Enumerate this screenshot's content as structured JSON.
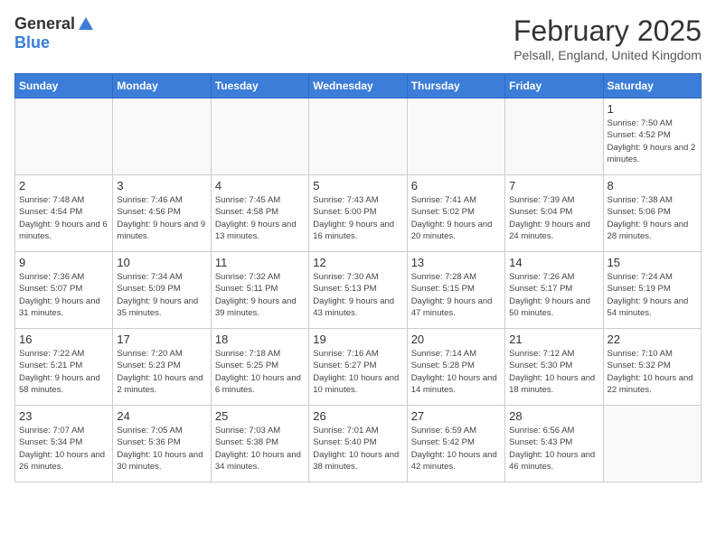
{
  "logo": {
    "general": "General",
    "blue": "Blue"
  },
  "title": "February 2025",
  "location": "Pelsall, England, United Kingdom",
  "weekdays": [
    "Sunday",
    "Monday",
    "Tuesday",
    "Wednesday",
    "Thursday",
    "Friday",
    "Saturday"
  ],
  "days": [
    {
      "num": "",
      "info": ""
    },
    {
      "num": "",
      "info": ""
    },
    {
      "num": "",
      "info": ""
    },
    {
      "num": "",
      "info": ""
    },
    {
      "num": "",
      "info": ""
    },
    {
      "num": "",
      "info": ""
    },
    {
      "num": "1",
      "info": "Sunrise: 7:50 AM\nSunset: 4:52 PM\nDaylight: 9 hours and 2 minutes."
    },
    {
      "num": "2",
      "info": "Sunrise: 7:48 AM\nSunset: 4:54 PM\nDaylight: 9 hours and 6 minutes."
    },
    {
      "num": "3",
      "info": "Sunrise: 7:46 AM\nSunset: 4:56 PM\nDaylight: 9 hours and 9 minutes."
    },
    {
      "num": "4",
      "info": "Sunrise: 7:45 AM\nSunset: 4:58 PM\nDaylight: 9 hours and 13 minutes."
    },
    {
      "num": "5",
      "info": "Sunrise: 7:43 AM\nSunset: 5:00 PM\nDaylight: 9 hours and 16 minutes."
    },
    {
      "num": "6",
      "info": "Sunrise: 7:41 AM\nSunset: 5:02 PM\nDaylight: 9 hours and 20 minutes."
    },
    {
      "num": "7",
      "info": "Sunrise: 7:39 AM\nSunset: 5:04 PM\nDaylight: 9 hours and 24 minutes."
    },
    {
      "num": "8",
      "info": "Sunrise: 7:38 AM\nSunset: 5:06 PM\nDaylight: 9 hours and 28 minutes."
    },
    {
      "num": "9",
      "info": "Sunrise: 7:36 AM\nSunset: 5:07 PM\nDaylight: 9 hours and 31 minutes."
    },
    {
      "num": "10",
      "info": "Sunrise: 7:34 AM\nSunset: 5:09 PM\nDaylight: 9 hours and 35 minutes."
    },
    {
      "num": "11",
      "info": "Sunrise: 7:32 AM\nSunset: 5:11 PM\nDaylight: 9 hours and 39 minutes."
    },
    {
      "num": "12",
      "info": "Sunrise: 7:30 AM\nSunset: 5:13 PM\nDaylight: 9 hours and 43 minutes."
    },
    {
      "num": "13",
      "info": "Sunrise: 7:28 AM\nSunset: 5:15 PM\nDaylight: 9 hours and 47 minutes."
    },
    {
      "num": "14",
      "info": "Sunrise: 7:26 AM\nSunset: 5:17 PM\nDaylight: 9 hours and 50 minutes."
    },
    {
      "num": "15",
      "info": "Sunrise: 7:24 AM\nSunset: 5:19 PM\nDaylight: 9 hours and 54 minutes."
    },
    {
      "num": "16",
      "info": "Sunrise: 7:22 AM\nSunset: 5:21 PM\nDaylight: 9 hours and 58 minutes."
    },
    {
      "num": "17",
      "info": "Sunrise: 7:20 AM\nSunset: 5:23 PM\nDaylight: 10 hours and 2 minutes."
    },
    {
      "num": "18",
      "info": "Sunrise: 7:18 AM\nSunset: 5:25 PM\nDaylight: 10 hours and 6 minutes."
    },
    {
      "num": "19",
      "info": "Sunrise: 7:16 AM\nSunset: 5:27 PM\nDaylight: 10 hours and 10 minutes."
    },
    {
      "num": "20",
      "info": "Sunrise: 7:14 AM\nSunset: 5:28 PM\nDaylight: 10 hours and 14 minutes."
    },
    {
      "num": "21",
      "info": "Sunrise: 7:12 AM\nSunset: 5:30 PM\nDaylight: 10 hours and 18 minutes."
    },
    {
      "num": "22",
      "info": "Sunrise: 7:10 AM\nSunset: 5:32 PM\nDaylight: 10 hours and 22 minutes."
    },
    {
      "num": "23",
      "info": "Sunrise: 7:07 AM\nSunset: 5:34 PM\nDaylight: 10 hours and 26 minutes."
    },
    {
      "num": "24",
      "info": "Sunrise: 7:05 AM\nSunset: 5:36 PM\nDaylight: 10 hours and 30 minutes."
    },
    {
      "num": "25",
      "info": "Sunrise: 7:03 AM\nSunset: 5:38 PM\nDaylight: 10 hours and 34 minutes."
    },
    {
      "num": "26",
      "info": "Sunrise: 7:01 AM\nSunset: 5:40 PM\nDaylight: 10 hours and 38 minutes."
    },
    {
      "num": "27",
      "info": "Sunrise: 6:59 AM\nSunset: 5:42 PM\nDaylight: 10 hours and 42 minutes."
    },
    {
      "num": "28",
      "info": "Sunrise: 6:56 AM\nSunset: 5:43 PM\nDaylight: 10 hours and 46 minutes."
    },
    {
      "num": "",
      "info": ""
    }
  ]
}
